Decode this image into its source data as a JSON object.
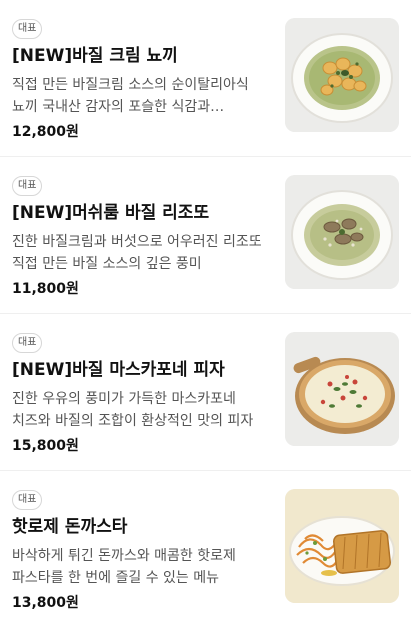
{
  "menu": {
    "items": [
      {
        "badge": "대표",
        "name": "[NEW]바질 크림 뇨끼",
        "description": "직접 만든 바질크림 소스의 순이탈리아식 뇨끼 국내산 감자의 포슬한 식감과 바질크림의 조화",
        "price": "12,800원",
        "image": "basil-cream-gnocchi-photo"
      },
      {
        "badge": "대표",
        "name": "[NEW]머쉬룸 바질 리조또",
        "description": "진한 바질크림과 버섯으로 어우러진 리조또 직접 만든 바질 소스의 깊은 풍미",
        "price": "11,800원",
        "image": "mushroom-basil-risotto-photo"
      },
      {
        "badge": "대표",
        "name": "[NEW]바질 마스카포네 피자",
        "description": "진한 우유의 풍미가 가득한 마스카포네 치즈와 바질의 조합이 환상적인 맛의 피자",
        "price": "15,800원",
        "image": "basil-mascarpone-pizza-photo"
      },
      {
        "badge": "대표",
        "name": "핫로제 돈까스타",
        "description": "바삭하게 튀긴 돈까스와 매콤한 핫로제 파스타를 한 번에 즐길 수 있는 메뉴",
        "price": "13,800원",
        "image": "hot-rose-tonkatsu-pasta-photo"
      }
    ]
  }
}
